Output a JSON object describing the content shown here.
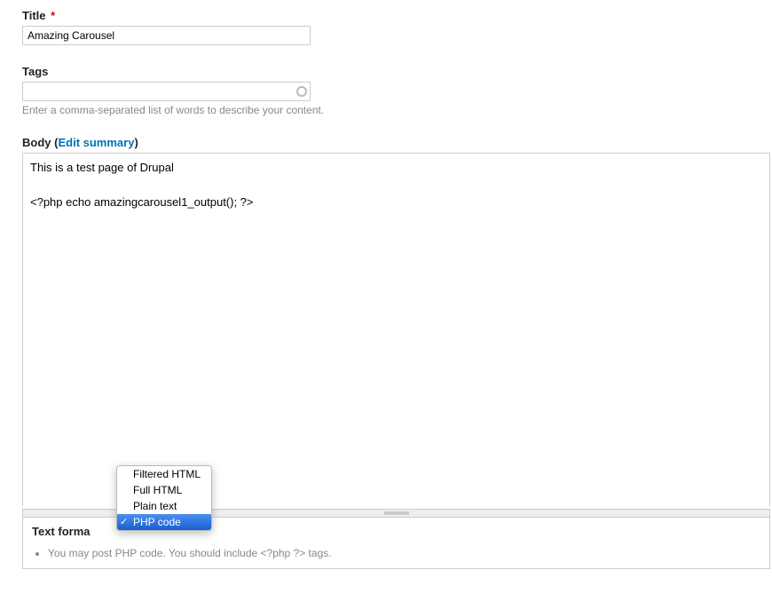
{
  "title": {
    "label": "Title",
    "value": "Amazing Carousel"
  },
  "tags": {
    "label": "Tags",
    "value": "",
    "hint": "Enter a comma-separated list of words to describe your content."
  },
  "body": {
    "label": "Body",
    "edit_summary_prefix": "(",
    "edit_summary_label": "Edit summary",
    "edit_summary_suffix": ")",
    "value": "This is a test page of Drupal\n\n<?php echo amazingcarousel1_output(); ?>"
  },
  "text_format": {
    "label": "Text forma",
    "options": [
      "Filtered HTML",
      "Full HTML",
      "Plain text",
      "PHP code"
    ],
    "selected_index": 3,
    "hints": [
      "You may post PHP code. You should include <?php ?> tags."
    ]
  }
}
